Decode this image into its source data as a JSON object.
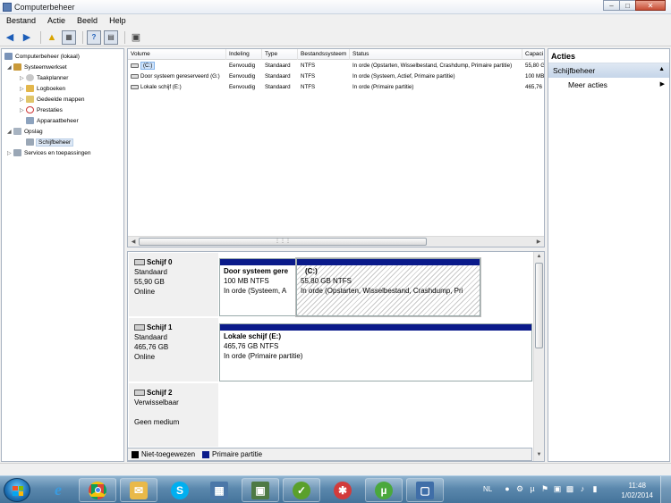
{
  "window": {
    "title": "Computerbeheer"
  },
  "menu": [
    "Bestand",
    "Actie",
    "Beeld",
    "Help"
  ],
  "tree": {
    "root": "Computerbeheer (lokaal)",
    "systeemwerkset": "Systeemwerkset",
    "taakplanner": "Taakplanner",
    "logboeken": "Logboeken",
    "gedeelde_mappen": "Gedeelde mappen",
    "prestaties": "Prestaties",
    "apparaatbeheer": "Apparaatbeheer",
    "opslag": "Opslag",
    "schijfbeheer": "Schijfbeheer",
    "services": "Services en toepassingen"
  },
  "volumes": {
    "columns": [
      "Volume",
      "Indeling",
      "Type",
      "Bestandssysteem",
      "Status",
      "Capaci"
    ],
    "rows": [
      [
        "(C:)",
        "Eenvoudig",
        "Standaard",
        "NTFS",
        "In orde (Opstarten, Wisselbestand, Crashdump, Primaire partitie)",
        "55,80 G"
      ],
      [
        "Door systeem gereserveerd (G:)",
        "Eenvoudig",
        "Standaard",
        "NTFS",
        "In orde (Systeem, Actief, Primaire partitie)",
        "100 MB"
      ],
      [
        "Lokale schijf (E:)",
        "Eenvoudig",
        "Standaard",
        "NTFS",
        "In orde (Primaire partitie)",
        "465,76"
      ]
    ]
  },
  "disks": {
    "d0": {
      "name": "Schijf 0",
      "type": "Standaard",
      "size": "55,90 GB",
      "state": "Online"
    },
    "d1": {
      "name": "Schijf 1",
      "type": "Standaard",
      "size": "465,76 GB",
      "state": "Online"
    },
    "d2": {
      "name": "Schijf 2",
      "type": "Verwisselbaar",
      "size": "",
      "state": "Geen medium"
    }
  },
  "partitions": {
    "p0a": {
      "name": "Door systeem gere",
      "size": "100 MB NTFS",
      "status": "In orde (Systeem, A"
    },
    "p0b": {
      "name": "(C:)",
      "size": "55,80 GB NTFS",
      "status": "In orde (Opstarten, Wisselbestand, Crashdump, Pri"
    },
    "p1a": {
      "name": "Lokale schijf  (E:)",
      "size": "465,76 GB NTFS",
      "status": "In orde (Primaire partitie)"
    }
  },
  "legend": {
    "unallocated": "Niet-toegewezen",
    "primary": "Primaire partitie"
  },
  "actions": {
    "title": "Acties",
    "section": "Schijfbeheer",
    "more": "Meer acties"
  },
  "taskbar": {
    "lang": "NL",
    "time": "11:48",
    "date": "1/02/2014"
  },
  "colors": {
    "primary_partition": "#0a1a8a",
    "unallocated": "#000000"
  }
}
